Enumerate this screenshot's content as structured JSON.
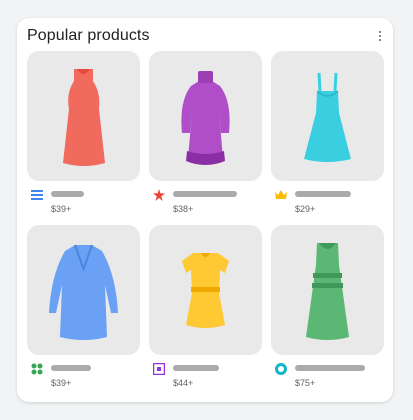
{
  "header": {
    "title": "Popular products"
  },
  "products": [
    {
      "price": "$39+",
      "source_icon": "blue-lines-logo-icon",
      "image": "red-sleeveless-dress"
    },
    {
      "price": "$38+",
      "source_icon": "red-flower-logo-icon",
      "image": "purple-long-sleeve-dress"
    },
    {
      "price": "$29+",
      "source_icon": "yellow-crown-logo-icon",
      "image": "cyan-strap-dress"
    },
    {
      "price": "$39+",
      "source_icon": "green-dots-logo-icon",
      "image": "blue-wrap-dress"
    },
    {
      "price": "$44+",
      "source_icon": "purple-square-logo-icon",
      "image": "yellow-short-dress"
    },
    {
      "price": "$75+",
      "source_icon": "teal-ring-logo-icon",
      "image": "green-striped-dress"
    }
  ],
  "colors": {
    "red": "#f06a5e",
    "purple": "#b04ec8",
    "cyan": "#3acfe0",
    "blue": "#6aa1f5",
    "yellow": "#ffc933",
    "green": "#5bb874"
  }
}
